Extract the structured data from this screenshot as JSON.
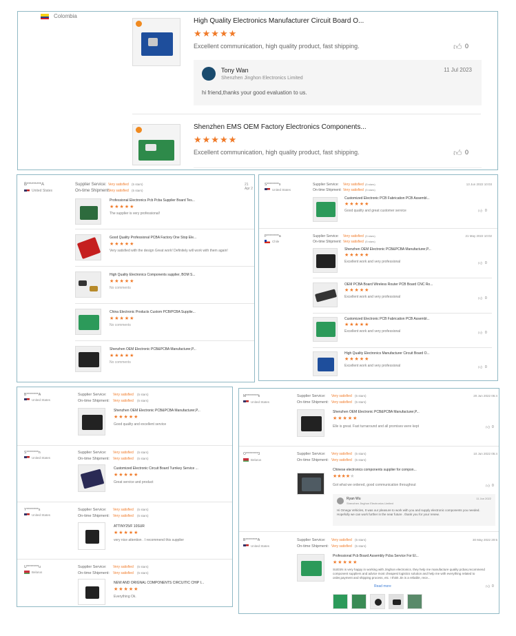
{
  "panel1": {
    "country": "Colombia",
    "reviews": [
      {
        "title": "High Quality Electronics Manufacturer Circuit Board O...",
        "rating": 5,
        "comment": "Excellent communication, high quality product, fast shipping.",
        "likes": "0",
        "reply": {
          "name": "Tony Wan",
          "company": "Shenzhen Jinghon Electronics Limited",
          "date": "11 Jul 2023",
          "text": "hi friend,thanks your good evaluation to us."
        }
      },
      {
        "title": "Shenzhen EMS OEM Factory Electronics Components...",
        "rating": 5,
        "comment": "Excellent communication, high quality product, fast shipping.",
        "likes": "0"
      }
    ]
  },
  "panel2": {
    "user": "B*********A",
    "country": "United States",
    "supplier_label": "Supplier Service:",
    "shipment_label": "On-time Shipment:",
    "status": "Very satisfied",
    "stars_note": "(5 stars)",
    "date": "21 Apr 2",
    "items": [
      {
        "title": "Professional Electronics Pcb Pcba Supplier Board Tes...",
        "comment": "The supplier is very professional!"
      },
      {
        "title": "Good Quality Professional PCBA Factory One Stop Ele...",
        "comment": "Very satisfied with the design Great work! Definitely will work with them again!"
      },
      {
        "title": "High Quality Electronics Components supplier, BOM S...",
        "comment": "No comments"
      },
      {
        "title": "China Electronic Products Custom PCB/PCBA Supplie...",
        "comment": "No comments"
      },
      {
        "title": "Shenzhen OEM Electronic PCB&PCBA Manufacturer,P...",
        "comment": "No comments"
      }
    ]
  },
  "panel3": {
    "groups": [
      {
        "user": "S*********s",
        "country": "United States",
        "date": "13 Jun 2022 10:03",
        "items": [
          {
            "title": "Customized Electronic PCB Fabrication PCB Assembl...",
            "comment": "Good quality and great customer service",
            "likes": "0"
          }
        ]
      },
      {
        "user": "P*********a",
        "country": "Chile",
        "date": "21 May 2022 10:02",
        "items": [
          {
            "title": "Shenzhen OEM Electronic PCB&PCBA Manufacturer,P...",
            "comment": "Excellent work and very professional",
            "likes": "0"
          },
          {
            "title": "OEM PCBA Board Wireless Router PCB Board CNC Ro...",
            "comment": "Excellent work and very professional",
            "likes": "0"
          },
          {
            "title": "Customized Electronic PCB Fabrication PCB Assembl...",
            "comment": "Excellent work and very professional",
            "likes": "0"
          },
          {
            "title": "High Quality Electronics Manufacturer Circuit Board O...",
            "comment": "Excellent work and very professional",
            "likes": "0"
          }
        ]
      }
    ],
    "supplier_label": "Supplier Service:",
    "shipment_label": "On-time Shipment:",
    "status": "Very satisfied",
    "stars_note": "(5 stars)"
  },
  "panel4": {
    "supplier_label": "Supplier Service:",
    "shipment_label": "On-time Shipment:",
    "status": "Very satisfied",
    "stars_note": "(5 stars)",
    "groups": [
      {
        "user": "B*********A",
        "country": "United States",
        "title": "Shenzhen OEM Electronic PCB&PCBA Manufacturer,P...",
        "comment": "Good quality and excellent service"
      },
      {
        "user": "S*********n",
        "country": "United States",
        "title": "Customized Electronic Circuit Board Turnkey Service ...",
        "comment": "Great service and product"
      },
      {
        "user": "Y*********s",
        "country": "United States",
        "title": "ATTINY25/F 10SUR",
        "comment": "very nice attention . I recommend this supplier"
      },
      {
        "user": "U*********u",
        "country": "Belarus",
        "title": "NEW AND ORIGNAL COMPONENTS CIRCUITIC CHIP I...",
        "comment": "Everything Ok."
      }
    ]
  },
  "panel5": {
    "supplier_label": "Supplier Service:",
    "shipment_label": "On-time Shipment:",
    "status": "Very satisfied",
    "stars_note": "(5 stars)",
    "groups": [
      {
        "user": "M*********k",
        "country": "United States",
        "date": "20 Jun 2022 05:4",
        "title": "Shenzhen OEM Electronic PCB&PCBA Manufacturer,P...",
        "comment": "Elle is great. Fast turnaround and all promises were kept",
        "likes": "0"
      },
      {
        "user": "O*********3",
        "country": "Belarus",
        "date": "10 Jun 2022 05:4",
        "title": "Chinese electronics components supplier for compon...",
        "comment": "Got what we ordered, good communication throughout",
        "likes": "0",
        "reply": {
          "name": "Ryan Wu",
          "company": "Shenzhen Jinghon Electronics Limited",
          "date": "11 Jun 2022",
          "text": "Hi Omega Vehicles, It was our pleasure to work with you and supply electronic components you needed. Hopefully we can work further in the near future . thank you for your renew."
        }
      },
      {
        "user": "B*********A",
        "country": "United States",
        "date": "30 May 2022 20:5",
        "title": "Professional Pcb Board Assembly Pcba Service For El...",
        "comment": "SUESN is very happy in working with Jinghon electronics. they help me manufacture quality pcbas,recommend component suppliers and advice most cheapest logistics solution and help me with everything related to order,payment and shipping process, etc. I think Jin is a reliable, rece...",
        "read_more": "Read more",
        "likes": "0"
      }
    ]
  }
}
